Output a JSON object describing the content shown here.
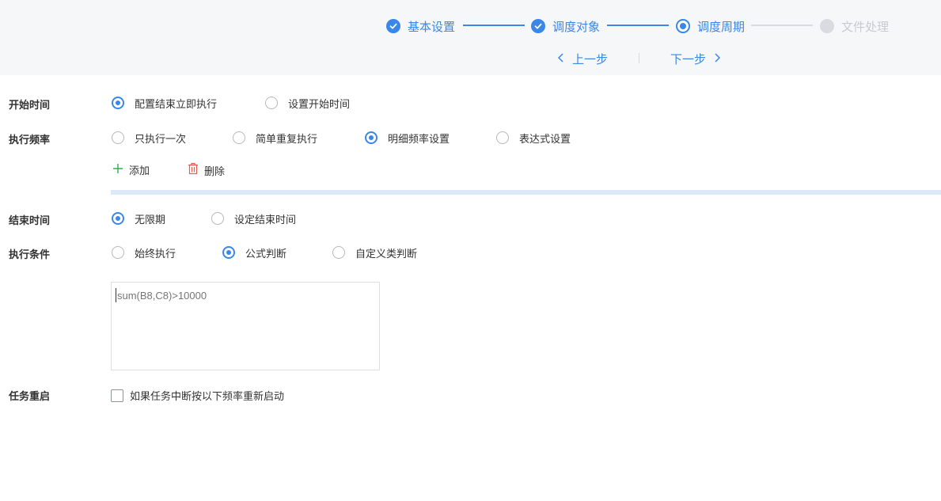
{
  "steps": [
    {
      "label": "基本设置",
      "state": "done"
    },
    {
      "label": "调度对象",
      "state": "done"
    },
    {
      "label": "调度周期",
      "state": "current"
    },
    {
      "label": "文件处理",
      "state": "pending"
    }
  ],
  "nav": {
    "prev_label": "上一步",
    "next_label": "下一步"
  },
  "start_time": {
    "label": "开始时间",
    "options": [
      "配置结束立即执行",
      "设置开始时间"
    ],
    "selected": 0
  },
  "frequency": {
    "label": "执行频率",
    "options": [
      "只执行一次",
      "简单重复执行",
      "明细频率设置",
      "表达式设置"
    ],
    "selected": 2,
    "add_label": "添加",
    "delete_label": "删除"
  },
  "end_time": {
    "label": "结束时间",
    "options": [
      "无限期",
      "设定结束时间"
    ],
    "selected": 0
  },
  "condition": {
    "label": "执行条件",
    "options": [
      "始终执行",
      "公式判断",
      "自定义类判断"
    ],
    "selected": 1,
    "formula_placeholder": "sum(B8,C8)>10000"
  },
  "restart": {
    "label": "任务重启",
    "checkbox_label": "如果任务中断按以下频率重新启动",
    "checked": false
  },
  "colors": {
    "accent": "#3a87e8",
    "pending": "#d9dbe0",
    "delete": "#e85a4f",
    "add": "#2bb24c"
  }
}
